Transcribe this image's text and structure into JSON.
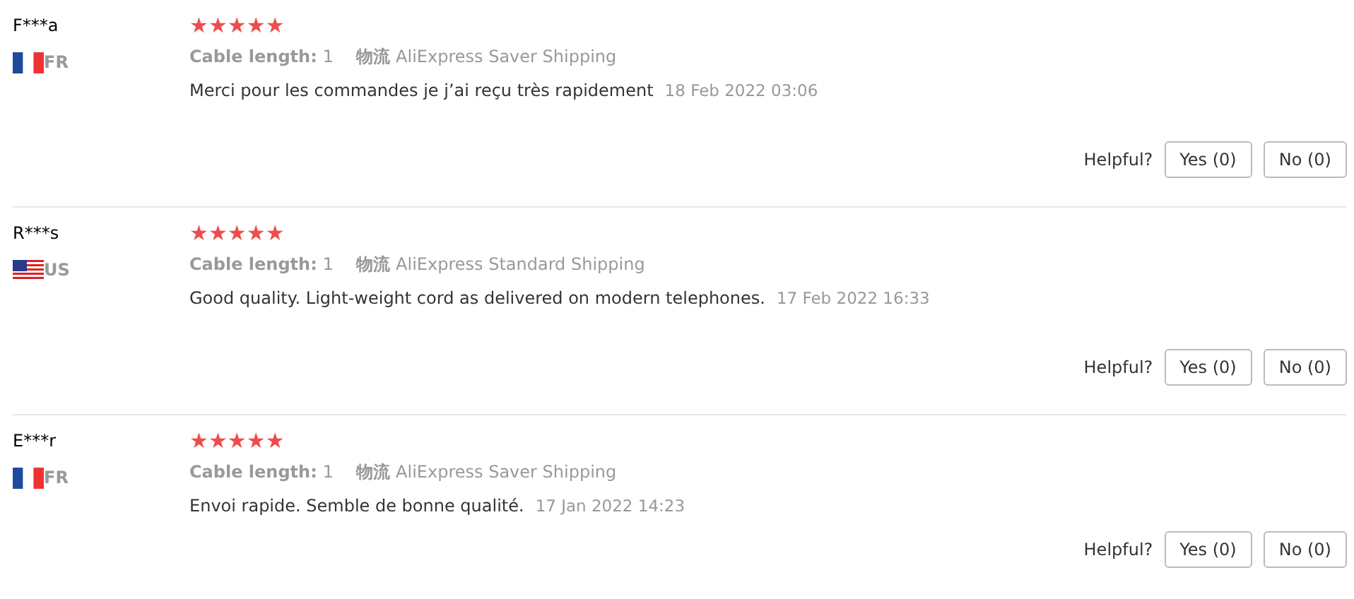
{
  "reviews": [
    {
      "user": "F***a",
      "kind": "tricolor",
      "country": "FR",
      "stars": 5,
      "attr_label": "Cable length:",
      "attr_value": "1",
      "shipping_label": "物流",
      "shipping": "AliExpress Saver Shipping",
      "text": "Merci pour les commandes je j’ai reçu très rapidement",
      "date": "18 Feb 2022 03:06",
      "helpful": "Helpful?",
      "yes": "Yes (0)",
      "no": "No (0)"
    },
    {
      "user": "R***s",
      "kind": "stripes",
      "country": "US",
      "stars": 5,
      "attr_label": "Cable length:",
      "attr_value": "1",
      "shipping_label": "物流",
      "shipping": "AliExpress Standard Shipping",
      "text": "Good quality. Light-weight cord as delivered on modern telephones.",
      "date": "17 Feb 2022 16:33",
      "helpful": "Helpful?",
      "yes": "Yes (0)",
      "no": "No (0)"
    },
    {
      "user": "E***r",
      "kind": "tricolor",
      "country": "FR",
      "stars": 5,
      "attr_label": "Cable length:",
      "attr_value": "1",
      "shipping_label": "物流",
      "shipping": "AliExpress Saver Shipping",
      "text": "Envoi rapide. Semble de bonne qualité.",
      "date": "17 Jan 2022 14:23",
      "helpful": "Helpful?",
      "yes": "Yes (0)",
      "no": "No (0)"
    }
  ]
}
